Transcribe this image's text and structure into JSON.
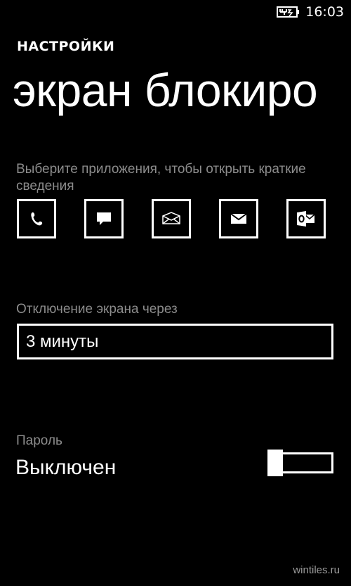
{
  "status_bar": {
    "time": "16:03",
    "battery_icon": "battery-charging-icon"
  },
  "header": {
    "app_title": "НАСТРОЙКИ",
    "page_title": "экран блокиро"
  },
  "quick_status": {
    "label": "Выберите приложения, чтобы открыть краткие сведения",
    "apps": [
      {
        "icon": "phone-icon"
      },
      {
        "icon": "messaging-icon"
      },
      {
        "icon": "email-icon"
      },
      {
        "icon": "mail-icon"
      },
      {
        "icon": "outlook-icon"
      }
    ]
  },
  "screen_timeout": {
    "label": "Отключение экрана через",
    "value": "3 минуты"
  },
  "password": {
    "label": "Пароль",
    "value": "Выключен",
    "toggle_on": false
  },
  "watermark": "wintiles.ru",
  "colors": {
    "background": "#000000",
    "foreground": "#ffffff",
    "subtle_text": "#8c8c8c"
  }
}
